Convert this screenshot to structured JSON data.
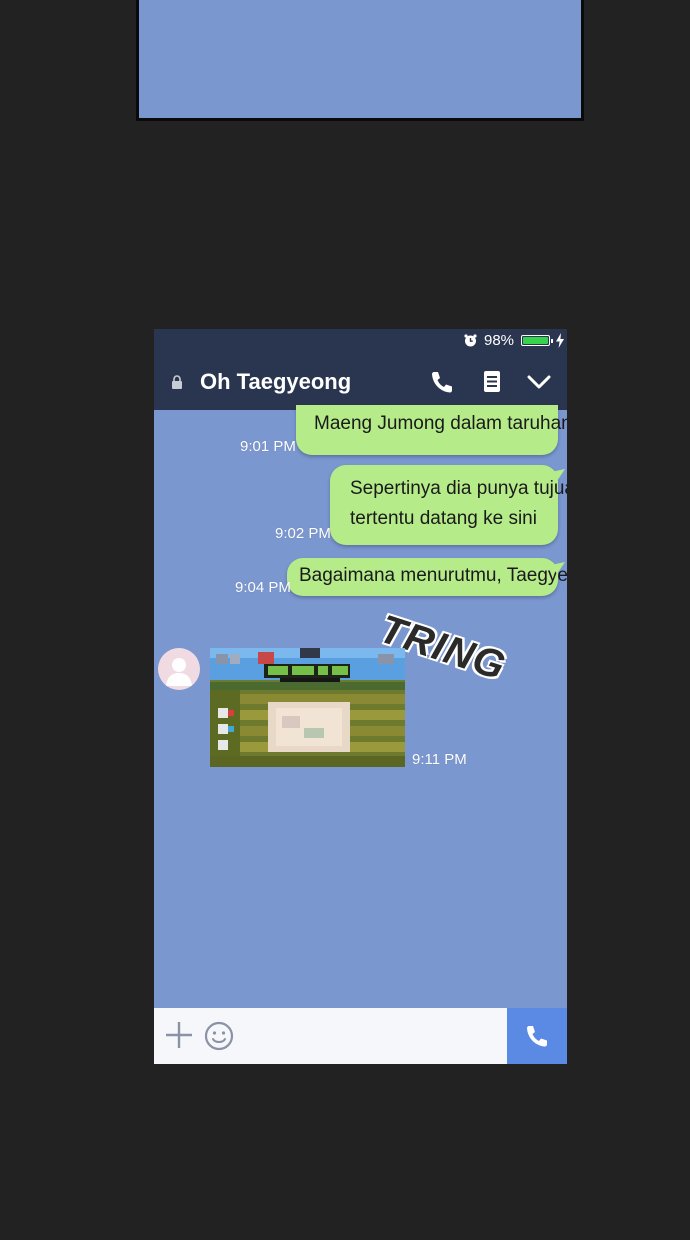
{
  "status_bar": {
    "battery_percent_label": "98%",
    "battery_level": 0.98,
    "alarm_icon": "alarm-clock-icon",
    "charging_icon": "lightning-bolt-icon"
  },
  "header": {
    "contact_name": "Oh Taegyeong",
    "icons": [
      "lock-icon",
      "phone-icon",
      "notes-icon",
      "chevron-down-icon"
    ]
  },
  "messages": [
    {
      "side": "outgoing",
      "lines": [
        "Maeng Jumong dalam taruhan."
      ],
      "time": "9:01 PM"
    },
    {
      "side": "outgoing",
      "lines": [
        "Sepertinya dia punya tujuan",
        "tertentu datang ke sini"
      ],
      "time": "9:02 PM"
    },
    {
      "side": "outgoing",
      "lines": [
        "Bagaimana menurutmu, Taegyeong?"
      ],
      "time": "9:04 PM"
    },
    {
      "side": "incoming",
      "type": "image",
      "time": "9:11 PM"
    }
  ],
  "sound_effect": "TRING",
  "input_bar": {
    "icons": [
      "plus-icon",
      "emoji-icon",
      "phone-icon"
    ]
  },
  "colors": {
    "background": "#222222",
    "chat_background": "#7b97cf",
    "header": "#2a3550",
    "bubble_outgoing": "#b6eb8a",
    "send_button": "#5b8ae4"
  }
}
